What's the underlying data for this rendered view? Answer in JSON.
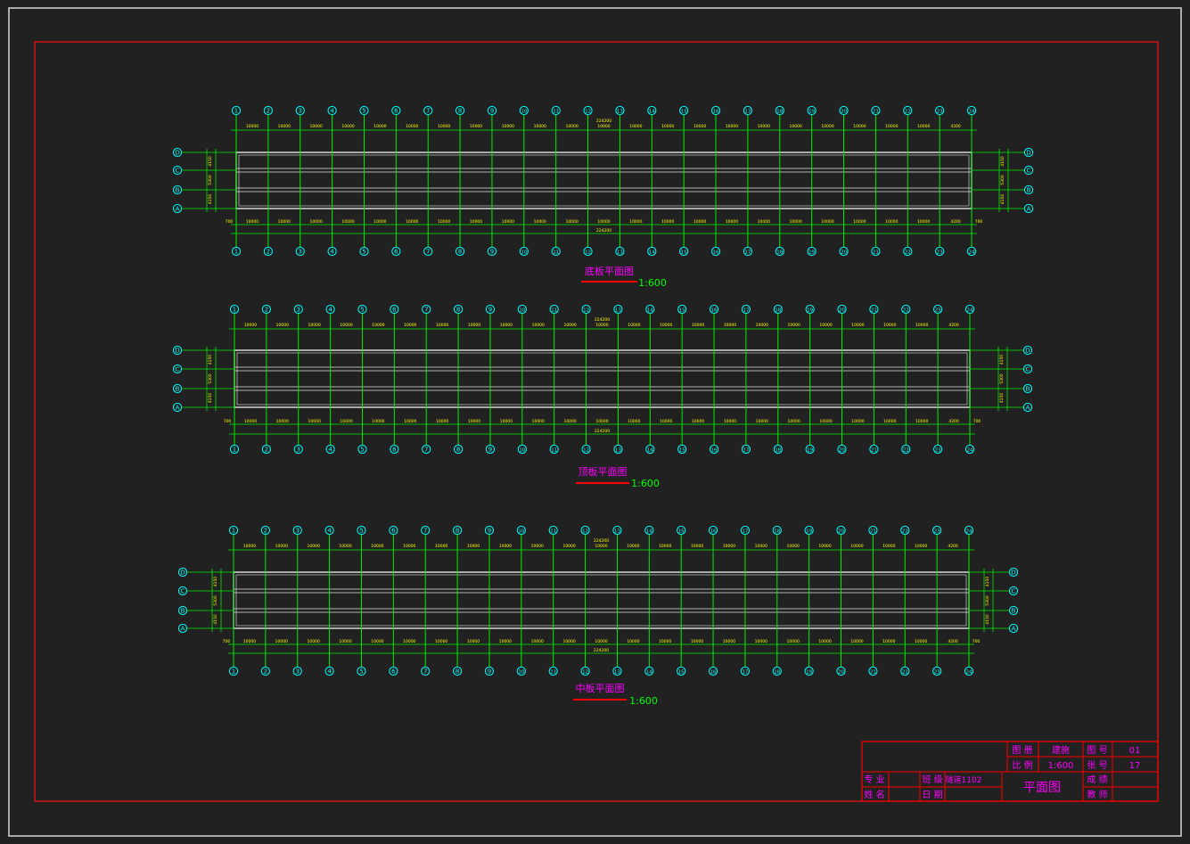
{
  "colors": {
    "background": "#212121",
    "outer_frame": "#d8d8d8",
    "inner_frame": "#ff1010",
    "axis_line": "#00ee00",
    "axis_bubble": "#00ffff",
    "dim_text": "#ffff00",
    "slab_outline": "#e6e6e6",
    "title_text": "#ff00ff",
    "scale_text": "#00ff00",
    "title_underline": "#ff0000",
    "table_line": "#ff0000",
    "table_text": "#ff00ff"
  },
  "plans": [
    {
      "id": "bottom",
      "title": "底板平面图",
      "scale": "1:600",
      "axis_labels": [
        "1",
        "2",
        "3",
        "4",
        "5",
        "6",
        "7",
        "8",
        "9",
        "10",
        "11",
        "12",
        "13",
        "14",
        "15",
        "16",
        "17",
        "18",
        "19",
        "20",
        "21",
        "22",
        "23",
        "24"
      ],
      "row_labels": [
        "D",
        "C",
        "B",
        "A"
      ],
      "span_dims": [
        "10000",
        "10000",
        "10000",
        "10000",
        "10000",
        "10000",
        "10000",
        "10000",
        "10000",
        "10000",
        "10000",
        "10000",
        "10000",
        "10000",
        "10000",
        "10000",
        "10000",
        "10000",
        "10000",
        "10000",
        "10000",
        "10000",
        "4200"
      ],
      "total_dim": "224200",
      "edge_dim": "700",
      "side_dims": [
        "4150",
        "5300",
        "4150"
      ]
    },
    {
      "id": "top",
      "title": "顶板平面图",
      "scale": "1:600",
      "axis_labels": [
        "1",
        "2",
        "3",
        "4",
        "5",
        "6",
        "7",
        "8",
        "9",
        "10",
        "11",
        "12",
        "13",
        "14",
        "15",
        "16",
        "17",
        "18",
        "19",
        "20",
        "21",
        "22",
        "23",
        "24"
      ],
      "row_labels": [
        "D",
        "C",
        "B",
        "A"
      ],
      "span_dims": [
        "10000",
        "10000",
        "10000",
        "10000",
        "10000",
        "10000",
        "10000",
        "10000",
        "10000",
        "10000",
        "10000",
        "10000",
        "10000",
        "10000",
        "10000",
        "10000",
        "10000",
        "10000",
        "10000",
        "10000",
        "10000",
        "10000",
        "4200"
      ],
      "total_dim": "224200",
      "edge_dim": "700",
      "side_dims": [
        "4150",
        "5300",
        "4150"
      ]
    },
    {
      "id": "middle",
      "title": "中板平面图",
      "scale": "1:600",
      "axis_labels": [
        "1",
        "2",
        "3",
        "4",
        "5",
        "6",
        "7",
        "8",
        "9",
        "10",
        "11",
        "12",
        "13",
        "14",
        "15",
        "16",
        "17",
        "18",
        "19",
        "20",
        "21",
        "22",
        "23",
        "24"
      ],
      "row_labels": [
        "D",
        "C",
        "B",
        "A"
      ],
      "span_dims": [
        "10000",
        "10000",
        "10000",
        "10000",
        "10000",
        "10000",
        "10000",
        "10000",
        "10000",
        "10000",
        "10000",
        "10000",
        "10000",
        "10000",
        "10000",
        "10000",
        "10000",
        "10000",
        "10000",
        "10000",
        "10000",
        "10000",
        "4200"
      ],
      "total_dim": "224200",
      "edge_dim": "700",
      "side_dims": [
        "4150",
        "5300",
        "4150"
      ]
    }
  ],
  "title_block": {
    "drawing_name": "平面图",
    "fields": [
      {
        "label": "图 册",
        "value": "建施"
      },
      {
        "label": "比 例",
        "value": "1:600"
      },
      {
        "label": "图 号",
        "value": "01"
      },
      {
        "label": "张 号",
        "value": "17"
      },
      {
        "label": "专 业",
        "value": ""
      },
      {
        "label": "班 级",
        "value": "隧道1102"
      },
      {
        "label": "姓 名",
        "value": ""
      },
      {
        "label": "日 期",
        "value": ""
      },
      {
        "label": "成 绩",
        "value": ""
      },
      {
        "label": "教 师",
        "value": ""
      }
    ]
  }
}
